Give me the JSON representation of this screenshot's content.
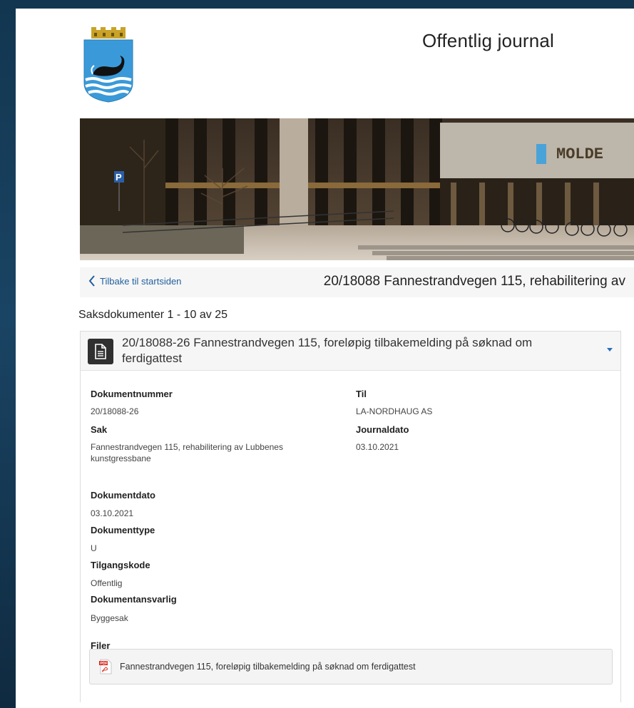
{
  "header": {
    "title": "Offentlig journal"
  },
  "hero": {
    "building_sign": "MOLDE",
    "parking_sign": "P"
  },
  "nav": {
    "back_label": "Tilbake til startsiden",
    "case_title": "20/18088 Fannestrandvegen 115, rehabilitering av"
  },
  "list": {
    "count_label": "Saksdokumenter 1 - 10 av 25"
  },
  "document": {
    "title": "20/18088-26 Fannestrandvegen 115, foreløpig tilbakemelding på søknad om ferdigattest",
    "fields": {
      "dokumentnummer": {
        "label": "Dokumentnummer",
        "value": "20/18088-26"
      },
      "sak": {
        "label": "Sak",
        "value": "Fannestrandvegen 115, rehabilitering av Lubbenes kunstgressbane"
      },
      "til": {
        "label": "Til",
        "value": "LA-NORDHAUG AS"
      },
      "journaldato": {
        "label": "Journaldato",
        "value": "03.10.2021"
      },
      "dokumentdato": {
        "label": "Dokumentdato",
        "value": "03.10.2021"
      },
      "dokumenttype": {
        "label": "Dokumenttype",
        "value": "U"
      },
      "tilgangskode": {
        "label": "Tilgangskode",
        "value": "Offentlig"
      },
      "dokumentansvarlig": {
        "label": "Dokumentansvarlig",
        "value": "Byggesak"
      }
    },
    "files_label": "Filer",
    "files": [
      {
        "name": "Fannestrandvegen 115, foreløpig tilbakemelding på søknad om ferdigattest",
        "type_badge": "PDF"
      }
    ]
  },
  "colors": {
    "link": "#1f5f9e",
    "caret": "#2a6ebb",
    "coat_blue": "#3a9ad9",
    "coat_gold": "#c9a227"
  }
}
